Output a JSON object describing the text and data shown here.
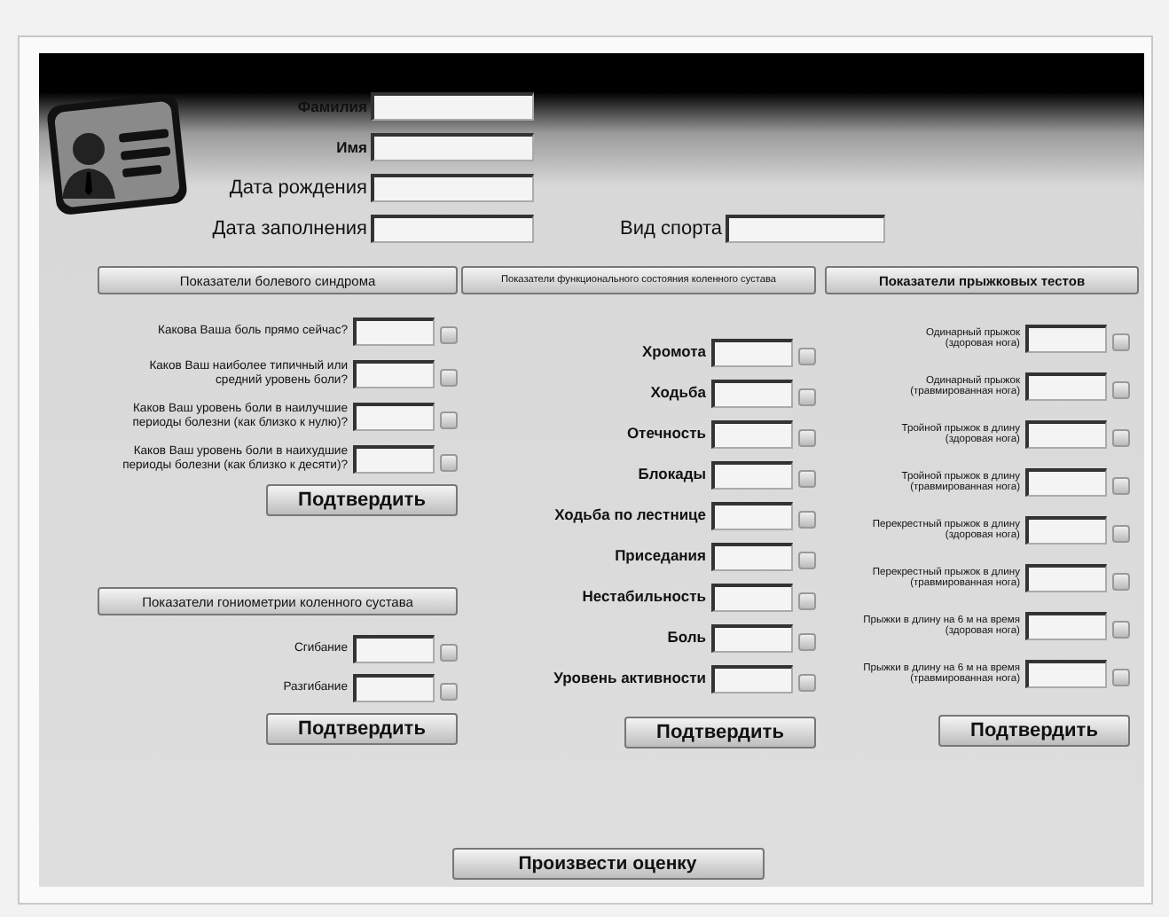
{
  "personal_fields": [
    {
      "label": "Фамилия"
    },
    {
      "label": "Имя"
    },
    {
      "label": "Дата рождения"
    },
    {
      "label": "Дата заполнения"
    }
  ],
  "sport_field": {
    "label": "Вид спорта"
  },
  "columns": [
    {
      "kind": "pain",
      "blocks": [
        {
          "title": "Показатели болевого синдрома",
          "rows": [
            {
              "label": "Какова Ваша боль прямо сейчас?"
            },
            {
              "label": "Каков Ваш наиболее типичный или\nсредний уровень боли?"
            },
            {
              "label": "Каков Ваш уровень боли в наилучшие\nпериоды болезни (как близко к нулю)?"
            },
            {
              "label": "Каков Ваш уровень боли в наихудшие\nпериоды болезни (как близко к десяти)?"
            }
          ],
          "confirm": "Подтвердить"
        },
        {
          "title": "Показатели гониометрии коленного сустава",
          "rows": [
            {
              "label": "Сгибание"
            },
            {
              "label": "Разгибание"
            }
          ],
          "confirm": "Подтвердить"
        }
      ]
    },
    {
      "kind": "function",
      "blocks": [
        {
          "title": "Показатели функционального состояния коленного сустава",
          "rows": [
            {
              "label": "Хромота"
            },
            {
              "label": "Ходьба"
            },
            {
              "label": "Отечность"
            },
            {
              "label": "Блокады"
            },
            {
              "label": "Ходьба по лестнице"
            },
            {
              "label": "Приседания"
            },
            {
              "label": "Нестабильность"
            },
            {
              "label": "Боль"
            },
            {
              "label": "Уровень активности"
            }
          ],
          "confirm": "Подтвердить"
        }
      ]
    },
    {
      "kind": "jump",
      "blocks": [
        {
          "title": "Показатели прыжковых тестов",
          "rows": [
            {
              "label": "Одинарный прыжок\n(здоровая нога)"
            },
            {
              "label": "Одинарный прыжок\n(травмированная нога)"
            },
            {
              "label": "Тройной прыжок в длину\n(здоровая нога)"
            },
            {
              "label": "Тройной прыжок в длину\n(травмированная нога)"
            },
            {
              "label": "Перекрестный прыжок в длину\n(здоровая нога)"
            },
            {
              "label": "Перекрестный прыжок в длину\n(травмированная нога)"
            },
            {
              "label": "Прыжки в длину на 6 м на время\n(здоровая нога)"
            },
            {
              "label": "Прыжки в длину на 6 м на время\n(травмированная нога)"
            }
          ],
          "confirm": "Подтвердить"
        }
      ]
    }
  ],
  "evaluate_button": "Произвести оценку"
}
